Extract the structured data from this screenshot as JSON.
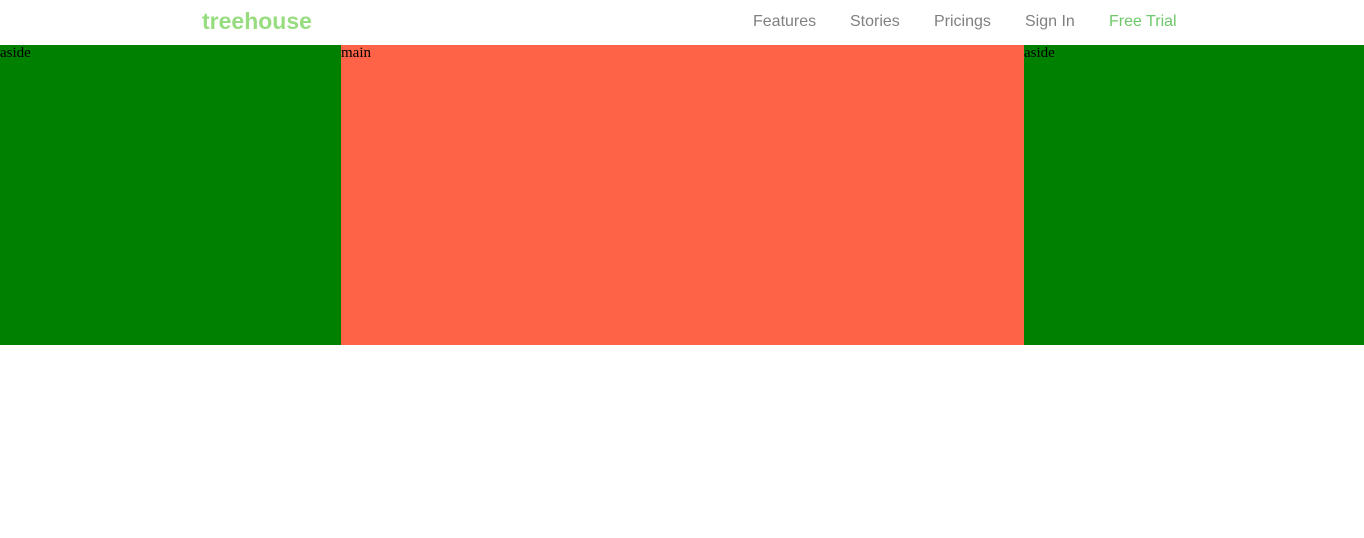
{
  "header": {
    "logo": "treehouse",
    "nav": [
      {
        "label": "Features"
      },
      {
        "label": "Stories"
      },
      {
        "label": "Pricings"
      },
      {
        "label": "Sign In"
      },
      {
        "label": "Free Trial"
      }
    ]
  },
  "layout": {
    "left_aside": {
      "label": "aside",
      "color": "#008000"
    },
    "main": {
      "label": "main",
      "color": "#ff6347"
    },
    "right_aside": {
      "label": "aside",
      "color": "#008000"
    }
  },
  "colors": {
    "logo": "#97dd80",
    "nav_text": "#808080",
    "cta_text": "#6dc96a"
  }
}
